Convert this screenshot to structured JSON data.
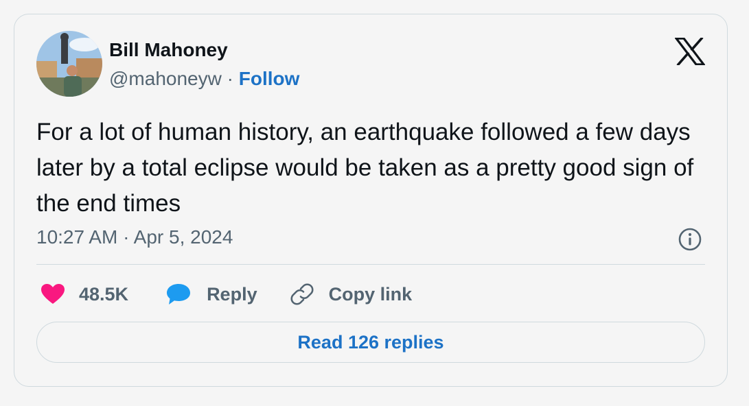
{
  "author": {
    "display_name": "Bill Mahoney",
    "handle": "@mahoneyw",
    "separator": "·",
    "follow_label": "Follow"
  },
  "tweet": {
    "text": "For a lot of human history, an earthquake followed a few days later by a total eclipse would be taken as a pretty good sign of the end times",
    "timestamp": "10:27 AM · Apr 5, 2024"
  },
  "actions": {
    "like_count": "48.5K",
    "reply_label": "Reply",
    "copy_link_label": "Copy link"
  },
  "read_replies_label": "Read 126 replies",
  "icons": {
    "logo": "x-logo-icon",
    "info": "info-icon",
    "like": "heart-icon",
    "reply": "speech-bubble-icon",
    "copy_link": "link-icon"
  },
  "colors": {
    "link_blue": "#1d72c6",
    "heart_pink": "#f91880",
    "reply_blue": "#1d9bf0",
    "secondary_text": "#536471",
    "border": "#cfd9de"
  }
}
